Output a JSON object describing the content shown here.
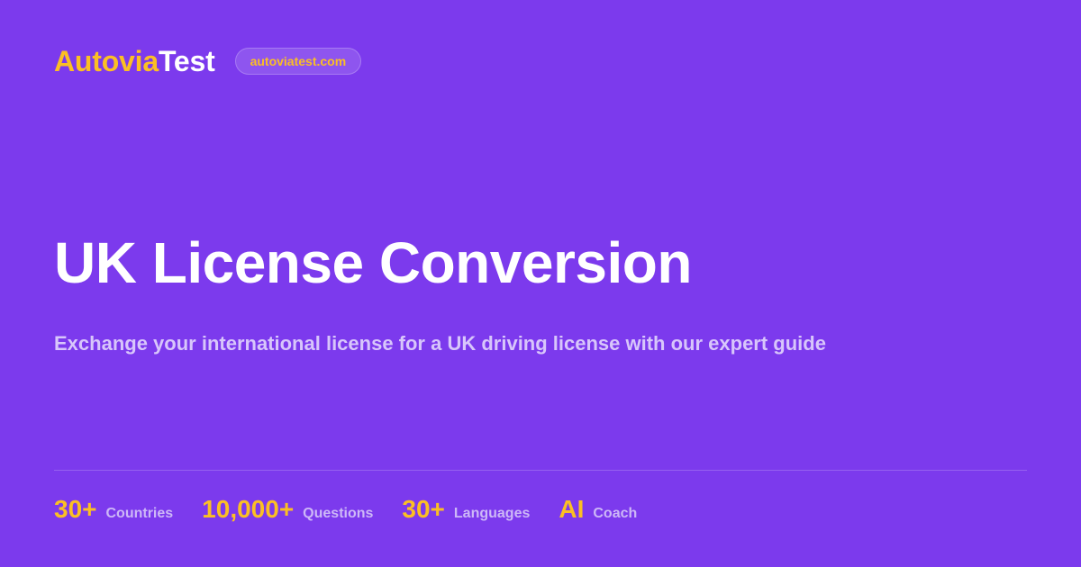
{
  "header": {
    "logo_part1": "Autovia",
    "logo_part2": "Test",
    "domain": "autoviatest.com"
  },
  "hero": {
    "title": "UK License Conversion",
    "subtitle": "Exchange your international license for a UK driving license with our expert guide"
  },
  "stats": [
    {
      "value": "30+",
      "label": "Countries"
    },
    {
      "value": "10,000+",
      "label": "Questions"
    },
    {
      "value": "30+",
      "label": "Languages"
    },
    {
      "value": "AI",
      "label": "Coach"
    }
  ],
  "colors": {
    "background": "#7c3aed",
    "accent": "#fbbf24",
    "text": "#ffffff",
    "muted_text": "#d8c6fb"
  }
}
